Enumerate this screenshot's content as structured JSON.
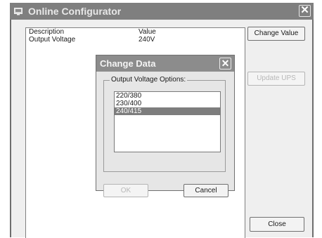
{
  "window": {
    "title": "Online Configurator",
    "close_glyph": "✕",
    "icon": "app-window-icon"
  },
  "list": {
    "headers": {
      "description": "Description",
      "value": "Value"
    },
    "rows": [
      {
        "description": "Output Voltage",
        "value": "240V"
      }
    ]
  },
  "buttons": {
    "change_value": "Change Value",
    "update_ups": "Update UPS",
    "close": "Close"
  },
  "dialog": {
    "title": "Change Data",
    "close_glyph": "✕",
    "group_label": "Output Voltage Options:",
    "options": [
      "220/380",
      "230/400",
      "240/415"
    ],
    "selected_index": 2,
    "ok_label": "OK",
    "cancel_label": "Cancel"
  },
  "colors": {
    "titlebar": "#7f7f7f",
    "selection": "#7d7d7d",
    "disabled_text": "#b8b8b8"
  }
}
